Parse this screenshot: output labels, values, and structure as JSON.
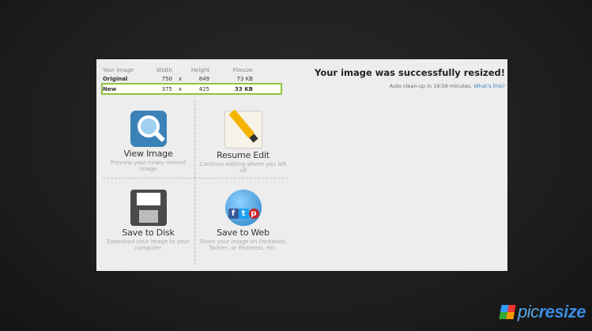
{
  "info": {
    "headers": [
      "Your Image",
      "Width",
      "",
      "Height",
      "Filesize"
    ],
    "original": {
      "label": "Original",
      "width": "750",
      "x": "x",
      "height": "849",
      "size": "73 KB"
    },
    "new": {
      "label": "New",
      "width": "375",
      "x": "x",
      "height": "425",
      "size": "33 KB"
    }
  },
  "message": {
    "success": "Your image was successfully resized!",
    "cleanup": "Auto clean-up in 19:56 minutes.",
    "whats_this": "What's this?"
  },
  "actions": {
    "view": {
      "title": "View Image",
      "desc": "Preview your newly resized image",
      "icon": "magnifier-icon"
    },
    "edit": {
      "title": "Resume Edit",
      "desc": "Continue editing where you left off",
      "icon": "pencil-icon"
    },
    "disk": {
      "title": "Save to Disk",
      "desc": "Download your image to your computer",
      "icon": "floppy-disk-icon"
    },
    "web": {
      "title": "Save to Web",
      "desc": "Share your image on Facebook, Twitter, or Pinterest, etc.",
      "icon": "globe-share-icon"
    }
  },
  "social": {
    "f": "f",
    "t": "t",
    "p": "p"
  },
  "brand": {
    "pic": "pic",
    "resize": "resize"
  },
  "colors": {
    "accent": "#8cc63f",
    "link": "#3a7fc4",
    "brand": "#3a8be0"
  }
}
